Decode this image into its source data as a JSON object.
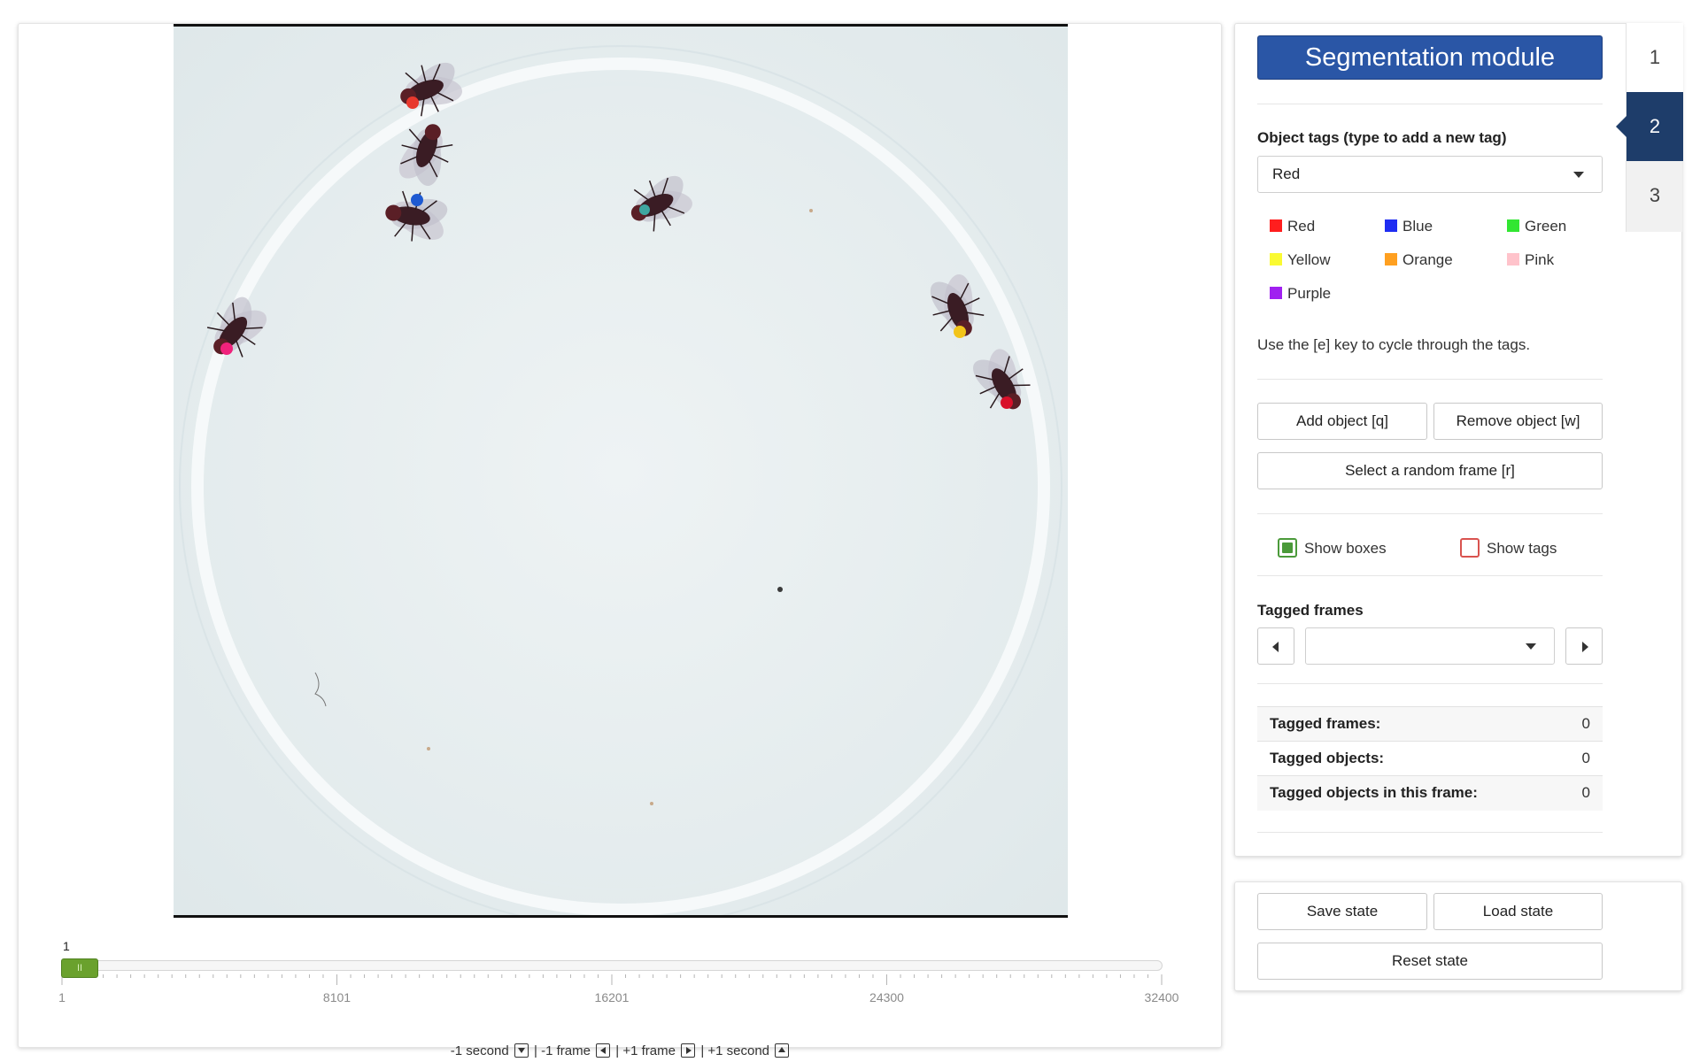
{
  "slider": {
    "current_frame": "1",
    "tick_labels": [
      "1",
      "8101",
      "16201",
      "24300",
      "32400"
    ],
    "handle_symbol": "II",
    "position_fraction": 0
  },
  "navigation": {
    "minus_second": "-1 second",
    "minus_frame": "| -1 frame",
    "plus_frame": "| +1 frame",
    "plus_second": "| +1 second"
  },
  "tabs": [
    "1",
    "2",
    "3"
  ],
  "active_tab": "2",
  "segmentation": {
    "title": "Segmentation module",
    "tags_label": "Object tags (type to add a new tag)",
    "selected_tag": "Red",
    "tags": [
      {
        "name": "Red",
        "color": "#ff1e1e"
      },
      {
        "name": "Blue",
        "color": "#1f2df2"
      },
      {
        "name": "Green",
        "color": "#32e632"
      },
      {
        "name": "Yellow",
        "color": "#fafa32"
      },
      {
        "name": "Orange",
        "color": "#ffa020"
      },
      {
        "name": "Pink",
        "color": "#ffc3cb"
      },
      {
        "name": "Purple",
        "color": "#a020f0"
      }
    ],
    "cycle_hint": "Use the [e] key to cycle through the tags.",
    "add_object": "Add object [q]",
    "remove_object": "Remove object [w]",
    "random_frame": "Select a random frame [r]",
    "show_boxes": "Show boxes",
    "show_boxes_checked": true,
    "show_tags": "Show tags",
    "show_tags_checked": false,
    "tagged_frames_label": "Tagged frames",
    "tagged_frames_value": "",
    "stats": [
      {
        "label": "Tagged frames:",
        "value": "0"
      },
      {
        "label": "Tagged objects:",
        "value": "0"
      },
      {
        "label": "Tagged objects in this frame:",
        "value": "0"
      }
    ]
  },
  "state": {
    "save": "Save state",
    "load": "Load state",
    "reset": "Reset state"
  },
  "fly_marker_colors": [
    "#e8392e",
    "#1e5ad2",
    "#3fa6a0",
    "#f0227c",
    "#f2c41a",
    "#d8102a"
  ],
  "colors": {
    "accent_blue": "#2a56a6",
    "tab_active": "#1e3d6a",
    "slider_green": "#6aa12d",
    "checkbox_green": "#4b9a3a",
    "checkbox_red": "#d9534f"
  }
}
